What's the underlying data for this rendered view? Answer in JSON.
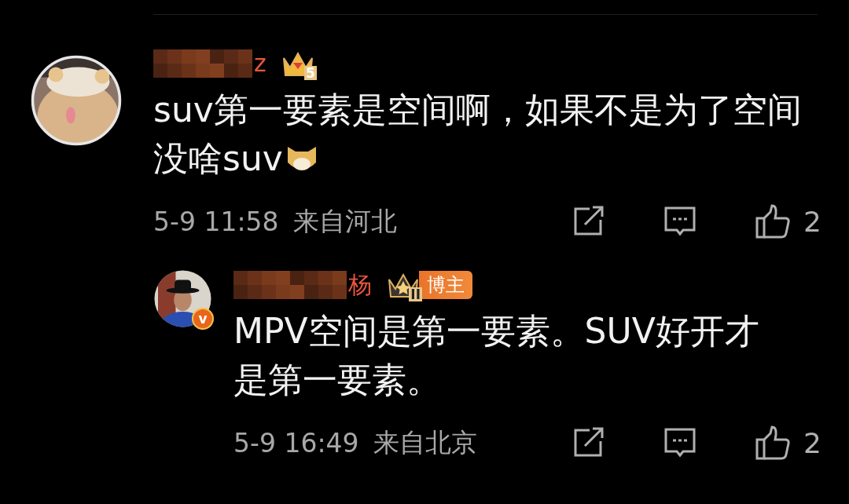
{
  "comments": [
    {
      "name_redacted": true,
      "username": "z",
      "crown_level": "5",
      "text": "suv第一要素是空间啊，如果不是为了空间没啥suv",
      "trailing_emoji": true,
      "time": "5-9 11:58",
      "location": "来自河北",
      "likes": "2",
      "replies": [
        {
          "name_redacted": true,
          "username": "杨",
          "crown_level": "II",
          "role_badge": "博主",
          "verified_mark": "v",
          "text": "MPV空间是第一要素。SUV好开才是第一要素。",
          "trailing_emoji": false,
          "time": "5-9 16:49",
          "location": "来自北京",
          "likes": "2"
        }
      ]
    }
  ]
}
